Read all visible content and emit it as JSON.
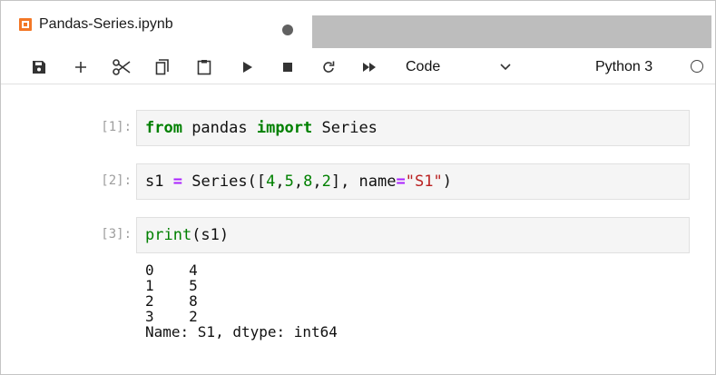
{
  "tab": {
    "title": "Pandas-Series.ipynb",
    "unsaved": true
  },
  "toolbar": {
    "buttons": [
      {
        "name": "save",
        "icon": "save-icon"
      },
      {
        "name": "insert-cell",
        "icon": "plus-icon"
      },
      {
        "name": "cut",
        "icon": "scissors-icon"
      },
      {
        "name": "copy",
        "icon": "copy-icon"
      },
      {
        "name": "paste",
        "icon": "paste-icon"
      },
      {
        "name": "run",
        "icon": "play-icon"
      },
      {
        "name": "interrupt",
        "icon": "stop-icon"
      },
      {
        "name": "restart",
        "icon": "restart-icon"
      },
      {
        "name": "run-all",
        "icon": "fast-forward-icon"
      }
    ],
    "cell_type": "Code",
    "kernel_name": "Python 3",
    "kernel_status": "idle"
  },
  "cells": [
    {
      "prompt": "[1]:",
      "code": "from pandas import Series"
    },
    {
      "prompt": "[2]:",
      "code": "s1 = Series([4,5,8,2], name=\"S1\")"
    },
    {
      "prompt": "[3]:",
      "code": "print(s1)",
      "output": "0    4\n1    5\n2    8\n3    2\nName: S1, dtype: int64"
    }
  ],
  "colors": {
    "keyword": "#008000",
    "operator": "#aa22ff",
    "string": "#ba2121",
    "prompt": "#9e9e9e",
    "tab_icon": "#f37726"
  }
}
